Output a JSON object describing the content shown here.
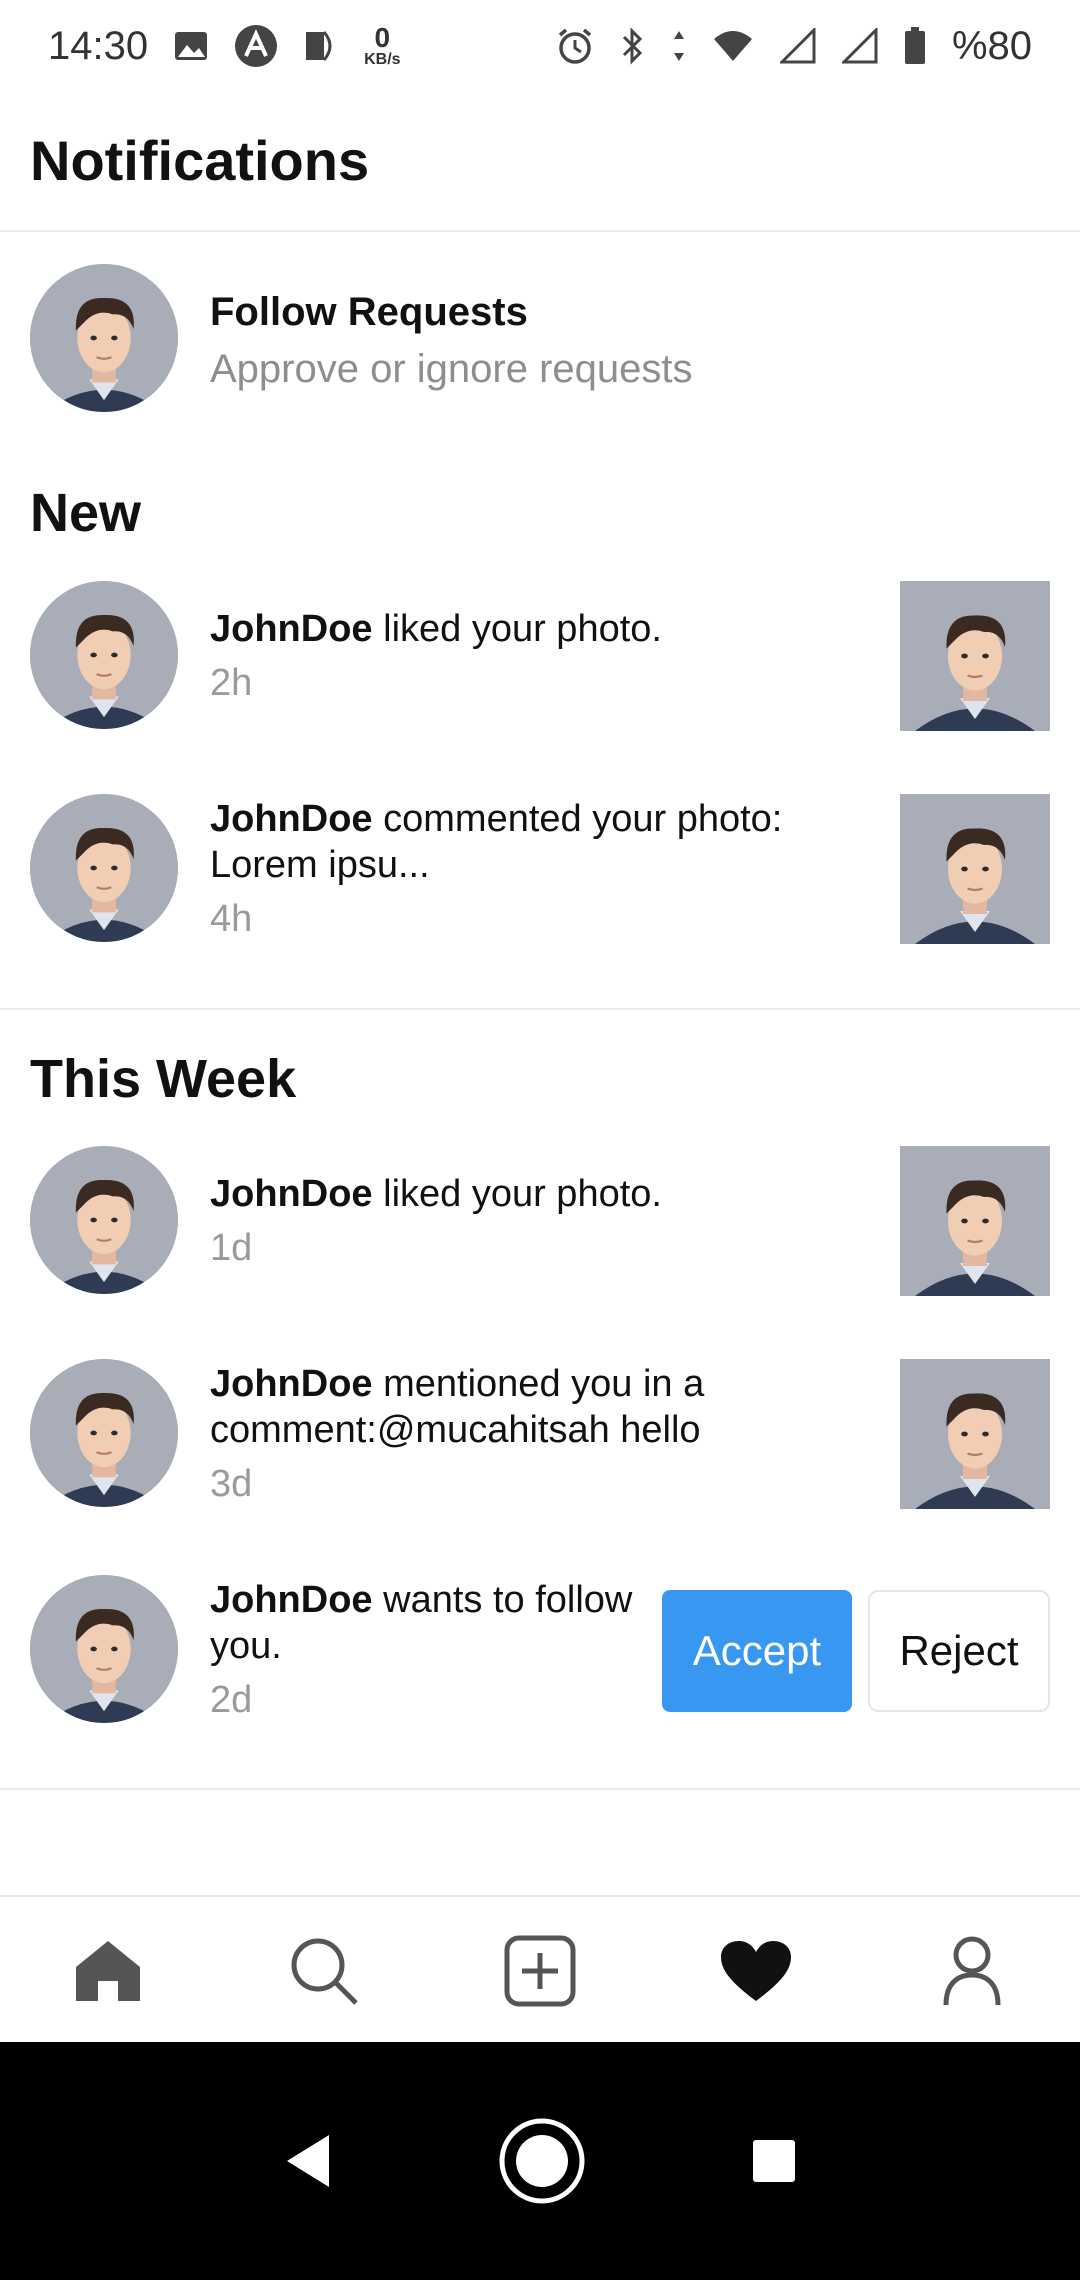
{
  "status_bar": {
    "time": "14:30",
    "kb_value": "0",
    "kb_unit": "KB/s",
    "battery": "%80",
    "icons": [
      "image-icon",
      "app-icon",
      "half-circle-icon",
      "alarm-icon",
      "bluetooth-icon",
      "data-arrows-icon",
      "wifi-icon",
      "signal-icon",
      "signal-icon",
      "battery-icon"
    ]
  },
  "page": {
    "title": "Notifications"
  },
  "follow_requests": {
    "title": "Follow Requests",
    "subtitle": "Approve or ignore requests"
  },
  "sections": {
    "new": "New",
    "this_week": "This Week"
  },
  "notifications": [
    {
      "user": "JohnDoe",
      "text": " liked your photo.",
      "time": "2h"
    },
    {
      "user": "JohnDoe",
      "text": " commented your photo: Lorem ipsu...",
      "time": "4h"
    },
    {
      "user": "JohnDoe",
      "text": " liked your photo.",
      "time": "1d"
    },
    {
      "user": "JohnDoe",
      "text": " mentioned you in a comment:@mucahitsah hello",
      "time": "3d"
    },
    {
      "user": "JohnDoe",
      "text": " wants to follow you.",
      "time": "2d"
    }
  ],
  "buttons": {
    "accept": "Accept",
    "reject": "Reject"
  },
  "bottom_nav": [
    "home-icon",
    "search-icon",
    "add-post-icon",
    "heart-icon",
    "profile-icon"
  ],
  "colors": {
    "accent": "#3897f0",
    "muted_text": "#8e8e8e"
  }
}
